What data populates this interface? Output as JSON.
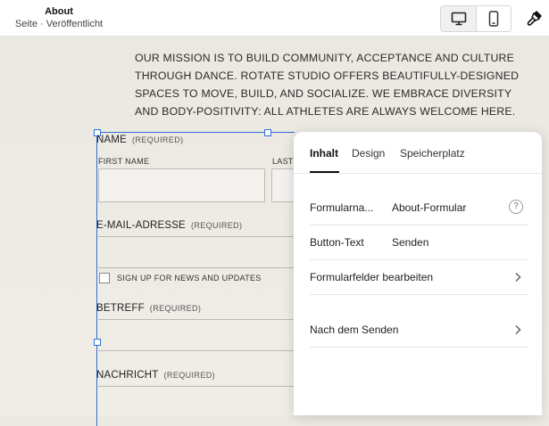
{
  "header": {
    "page_title": "About",
    "page_subtitle": "Seite · Veröffentlicht",
    "device_toggle": {
      "desktop_icon": "desktop-icon",
      "mobile_icon": "mobile-icon",
      "selected": "desktop"
    },
    "design_icon": "paintbrush-icon"
  },
  "content": {
    "mission_text": "OUR MISSION IS TO BUILD COMMUNITY, ACCEPTANCE AND CULTURE THROUGH DANCE. ROTATE STUDIO OFFERS BEAUTIFULLY-DESIGNED SPACES TO MOVE, BUILD, AND SOCIALIZE. WE EMBRACE DIVERSITY AND BODY-POSITIVITY: ALL ATHLETES ARE ALWAYS WELCOME HERE."
  },
  "form": {
    "required_tag": "(REQUIRED)",
    "name_label": "NAME",
    "first_name_label": "FIRST NAME",
    "last_name_label": "LAST",
    "email_label": "E-MAIL-ADRESSE",
    "newsletter_label": "SIGN UP FOR NEWS AND UPDATES",
    "subject_label": "BETREFF",
    "message_label": "NACHRICHT"
  },
  "panel": {
    "tabs": [
      {
        "label": "Inhalt",
        "active": true
      },
      {
        "label": "Design",
        "active": false
      },
      {
        "label": "Speicherplatz",
        "active": false
      }
    ],
    "rows": {
      "form_name": {
        "label": "Formularna...",
        "value": "About-Formular",
        "icon": "help-icon"
      },
      "button_text": {
        "label": "Button-Text",
        "value": "Senden"
      },
      "edit_fields": {
        "label": "Formularfelder bearbeiten",
        "icon": "chevron-right-icon"
      },
      "after_submit": {
        "label": "Nach dem Senden",
        "icon": "chevron-right-icon"
      }
    }
  },
  "colors": {
    "selection": "#2f6fd6",
    "canvas_bg": "#ece9e2",
    "panel_bg": "#ffffff"
  }
}
